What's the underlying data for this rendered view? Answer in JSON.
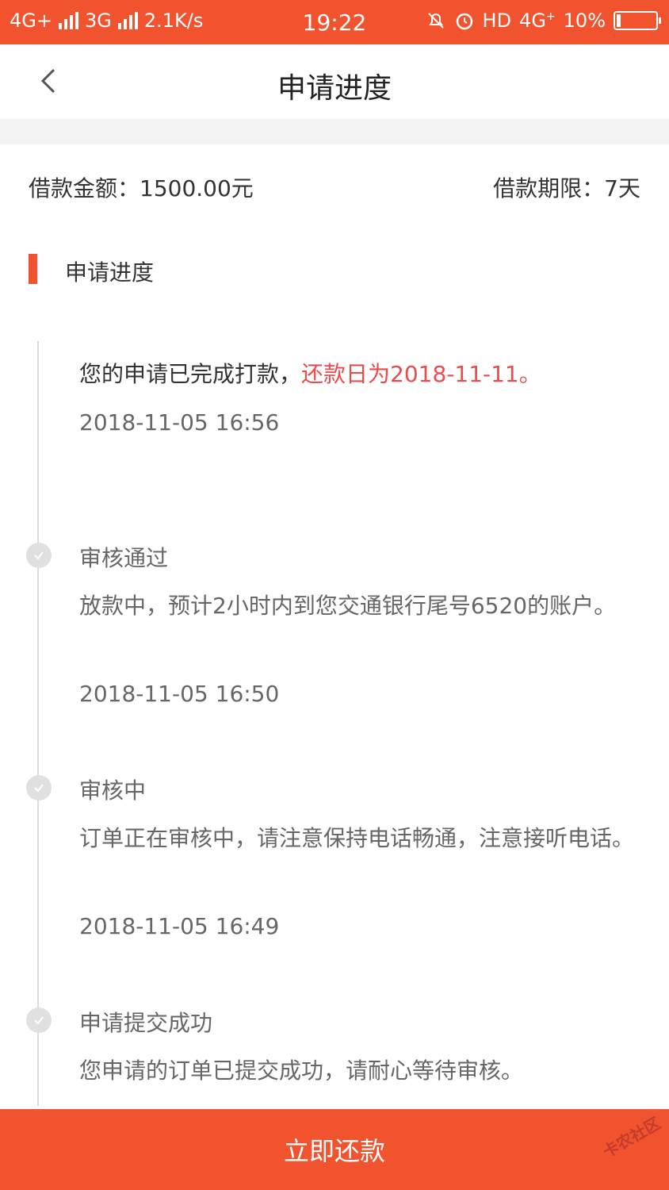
{
  "status_bar": {
    "network1": "4G+",
    "network2": "3G",
    "speed": "2.1K/s",
    "time": "19:22",
    "hd": "HD",
    "network3": "4G",
    "battery_text": "10%",
    "battery_level": 0.1
  },
  "nav": {
    "title": "申请进度",
    "back_icon": "chevron-left-icon"
  },
  "summary": {
    "amount_label": "借款金额：",
    "amount_value": "1500.00元",
    "term_label": "借款期限：",
    "term_value": "7天"
  },
  "section": {
    "title": "申请进度"
  },
  "steps": [
    {
      "title": "",
      "desc_main": "您的申请已完成打款，",
      "desc_highlight": "还款日为2018-11-11。",
      "time": "2018-11-05 16:56"
    },
    {
      "title": "审核通过",
      "desc": "放款中，预计2小时内到您交通银行尾号6520的账户。",
      "time": "2018-11-05 16:50"
    },
    {
      "title": "审核中",
      "desc": "订单正在审核中，请注意保持电话畅通，注意接听电话。",
      "time": "2018-11-05 16:49"
    },
    {
      "title": "申请提交成功",
      "desc": "您申请的订单已提交成功，请耐心等待审核。",
      "time": ""
    }
  ],
  "button": {
    "label": "立即还款"
  },
  "watermark": "卡农社区",
  "colors": {
    "accent": "#f2532f",
    "highlight": "#ec4b4b",
    "dot": "#e0e0e0"
  }
}
